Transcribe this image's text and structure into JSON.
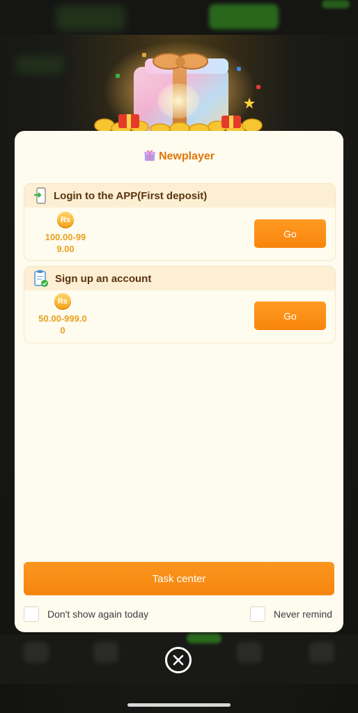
{
  "modal": {
    "title": "Newplayer",
    "tasks": [
      {
        "label": "Login to the APP(First deposit)",
        "currency_badge": "Rs",
        "amount": "100.00-999.00",
        "button_label": "Go"
      },
      {
        "label": "Sign up an account",
        "currency_badge": "Rs",
        "amount": "50.00-999.00",
        "button_label": "Go"
      }
    ],
    "task_center_label": "Task center",
    "dont_show_today_label": "Don't show again today",
    "never_remind_label": "Never remind"
  },
  "colors": {
    "accent": "#f8850c",
    "title": "#e0760a",
    "amount": "#e8a11f",
    "modal_bg": "#fefbef"
  },
  "icons": {
    "title_icon": "gift-icon",
    "task1_icon": "phone-login-icon",
    "task2_icon": "clipboard-check-icon",
    "close_icon": "close-icon"
  }
}
